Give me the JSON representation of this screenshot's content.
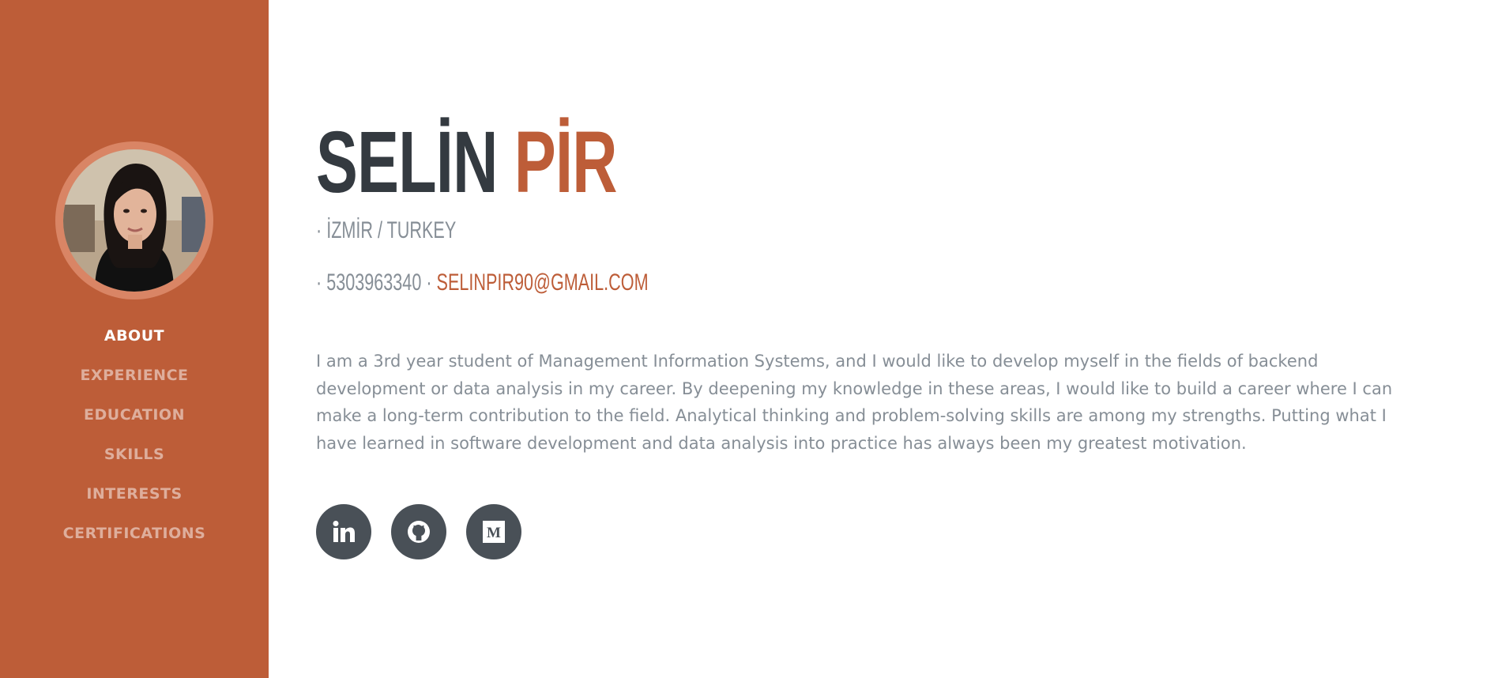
{
  "sidebar": {
    "avatar_alt": "Profile photo",
    "nav": [
      {
        "label": "ABOUT",
        "active": true
      },
      {
        "label": "EXPERIENCE",
        "active": false
      },
      {
        "label": "EDUCATION",
        "active": false
      },
      {
        "label": "SKILLS",
        "active": false
      },
      {
        "label": "INTERESTS",
        "active": false
      },
      {
        "label": "CERTIFICATIONS",
        "active": false
      }
    ]
  },
  "profile": {
    "first_name": "SELİN",
    "last_name": "PİR",
    "bullet": "·",
    "location": "İZMİR / TURKEY",
    "phone": "5303963340",
    "email": "SELINPIR90@GMAIL.COM",
    "bio": "I am a 3rd year student of Management Information Systems, and I would like to develop myself in the fields of backend development or data analysis in my career. By deepening my knowledge in these areas, I would like to build a career where I can make a long-term contribution to the field. Analytical thinking and problem-solving skills are among my strengths. Putting what I have learned in software development and data analysis into practice has always been my greatest motivation."
  },
  "social": [
    {
      "icon": "linkedin-icon"
    },
    {
      "icon": "github-icon"
    },
    {
      "icon": "medium-icon"
    }
  ],
  "colors": {
    "primary": "#bd5d38",
    "dark": "#343a40",
    "muted": "#868e96",
    "social_bg": "#495057"
  }
}
